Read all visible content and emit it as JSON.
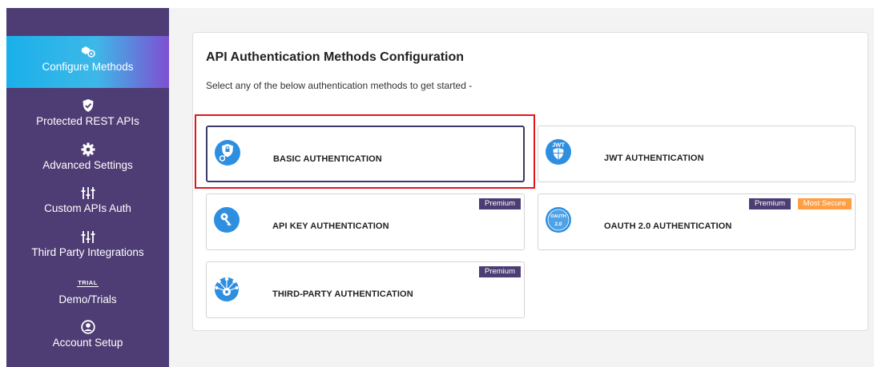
{
  "sidebar": {
    "items": [
      {
        "label": "Configure Methods",
        "icon": "gear-key-icon"
      },
      {
        "label": "Protected REST APIs",
        "icon": "shield-check-icon"
      },
      {
        "label": "Advanced Settings",
        "icon": "gear-icon"
      },
      {
        "label": "Custom APIs Auth",
        "icon": "sliders-icon"
      },
      {
        "label": "Third Party Integrations",
        "icon": "sliders-icon"
      },
      {
        "label": "Demo/Trials",
        "icon": "trial-icon",
        "icon_text": "TRIAL"
      },
      {
        "label": "Account Setup",
        "icon": "user-circle-icon"
      }
    ]
  },
  "main": {
    "title": "API Authentication Methods Configuration",
    "subtitle": "Select any of the below authentication methods to get started -",
    "cards": [
      {
        "label": "BASIC AUTHENTICATION",
        "icon": "shield-key-icon",
        "badges": []
      },
      {
        "label": "JWT AUTHENTICATION",
        "icon": "jwt-shield-icon",
        "icon_text": "JWT",
        "badges": []
      },
      {
        "label": "API KEY AUTHENTICATION",
        "icon": "key-icon",
        "badges": [
          "Premium"
        ]
      },
      {
        "label": "OAUTH 2.0 AUTHENTICATION",
        "icon": "oauth-icon",
        "icon_text": "OAUTH 2.0",
        "badges": [
          "Premium",
          "Most Secure"
        ]
      },
      {
        "label": "THIRD-PARTY AUTHENTICATION",
        "icon": "network-icon",
        "badges": [
          "Premium"
        ]
      }
    ]
  },
  "colors": {
    "sidebar_bg": "#4e3d74",
    "active_gradient_start": "#1ab0ea",
    "active_gradient_end": "#7f4fd2",
    "premium_badge": "#4c3e74",
    "secure_badge": "#ff9f43",
    "highlight": "#e4161b",
    "icon_blue": "#2e8fe0"
  }
}
